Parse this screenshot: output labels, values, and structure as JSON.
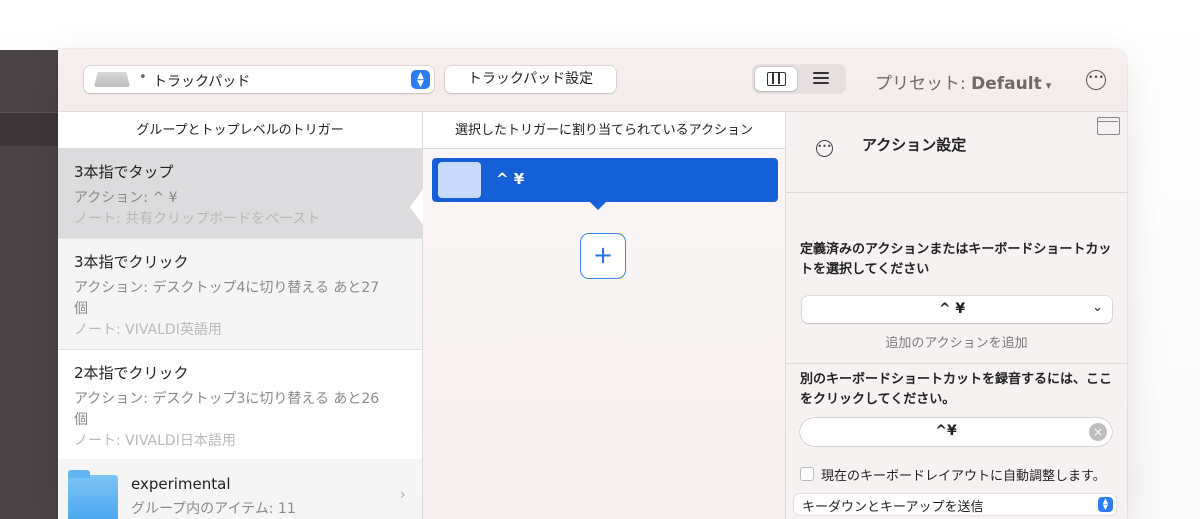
{
  "toolbar": {
    "trigger_bullet": "•",
    "trigger_label": "トラックパッド",
    "settings_button": "トラックパッド設定",
    "preset_prefix": "プリセット:",
    "preset_value": "Default",
    "preset_caret": "▾",
    "more": "•••"
  },
  "left": {
    "header": "グループとトップレベルのトリガー",
    "items": [
      {
        "title": "3本指でタップ",
        "action": "アクション: ^ ¥",
        "note": "ノート: 共有クリップボードをペースト"
      },
      {
        "title": "3本指でクリック",
        "action": "アクション: デスクトップ4に切り替える あと27個",
        "note": "ノート: VIVALDI英語用"
      },
      {
        "title": "2本指でクリック",
        "action": "アクション: デスクトップ3に切り替える あと26個",
        "note": "ノート: VIVALDI日本語用"
      }
    ],
    "folder": {
      "name": "experimental",
      "count": "グループ内のアイテム: 11",
      "chevron": "›"
    }
  },
  "middle": {
    "header": "選択したトリガーに割り当てられているアクション",
    "action_label": "^ ¥",
    "add": "+"
  },
  "inspector": {
    "title": "アクション設定",
    "ellipsis": "•••",
    "section1": "定義済みのアクションまたはキーボードショートカットを選択してください",
    "shortcut_value": "^ ¥",
    "shortcut_chevron": "⌄",
    "add_action": "追加のアクションを追加",
    "section2": "別のキーボードショートカットを録音するには、ここをクリックしてください。",
    "record_value": "^¥",
    "clear": "×",
    "auto_adjust": "現在のキーボードレイアウトに自動調整します。",
    "send_mode": "キーダウンとキーアップを送信"
  }
}
